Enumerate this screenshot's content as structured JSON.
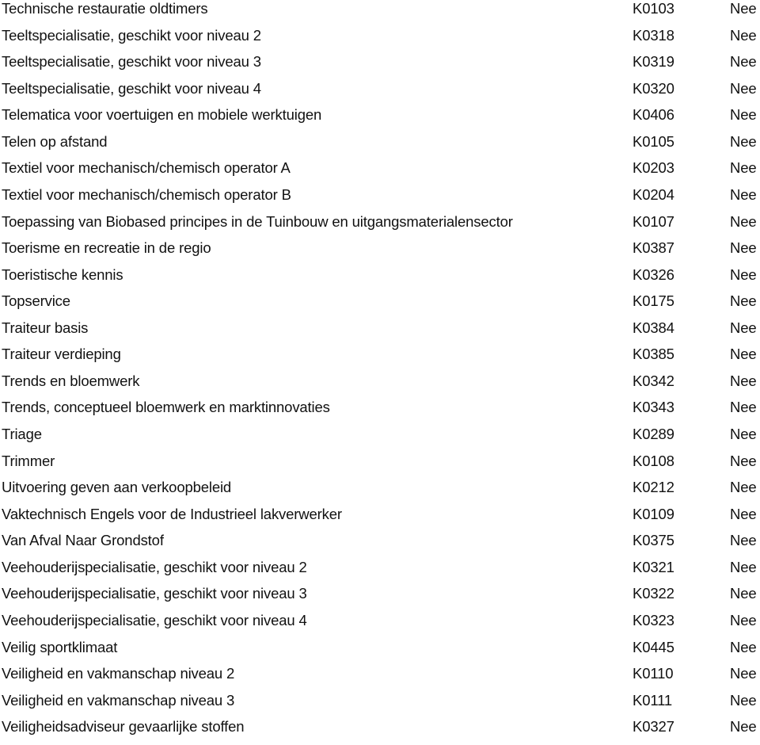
{
  "table": {
    "rows": [
      {
        "name": "Technische restauratie oldtimers",
        "code": "K0103",
        "value": "Nee"
      },
      {
        "name": "Teeltspecialisatie, geschikt voor niveau 2",
        "code": "K0318",
        "value": "Nee"
      },
      {
        "name": "Teeltspecialisatie, geschikt voor niveau 3",
        "code": "K0319",
        "value": "Nee"
      },
      {
        "name": "Teeltspecialisatie, geschikt voor niveau 4",
        "code": "K0320",
        "value": "Nee"
      },
      {
        "name": "Telematica voor voertuigen en mobiele werktuigen",
        "code": "K0406",
        "value": "Nee"
      },
      {
        "name": "Telen op afstand",
        "code": "K0105",
        "value": "Nee"
      },
      {
        "name": "Textiel voor mechanisch/chemisch operator A",
        "code": "K0203",
        "value": "Nee"
      },
      {
        "name": "Textiel voor mechanisch/chemisch operator B",
        "code": "K0204",
        "value": "Nee"
      },
      {
        "name": "Toepassing van Biobased principes in de Tuinbouw en uitgangsmaterialensector",
        "code": "K0107",
        "value": "Nee"
      },
      {
        "name": "Toerisme en recreatie in de regio",
        "code": "K0387",
        "value": "Nee"
      },
      {
        "name": "Toeristische kennis",
        "code": "K0326",
        "value": "Nee"
      },
      {
        "name": "Topservice",
        "code": "K0175",
        "value": "Nee"
      },
      {
        "name": "Traiteur basis",
        "code": "K0384",
        "value": "Nee"
      },
      {
        "name": "Traiteur verdieping",
        "code": "K0385",
        "value": "Nee"
      },
      {
        "name": "Trends en bloemwerk",
        "code": "K0342",
        "value": "Nee"
      },
      {
        "name": "Trends, conceptueel bloemwerk en marktinnovaties",
        "code": "K0343",
        "value": "Nee"
      },
      {
        "name": "Triage",
        "code": "K0289",
        "value": "Nee"
      },
      {
        "name": "Trimmer",
        "code": "K0108",
        "value": "Nee"
      },
      {
        "name": "Uitvoering geven aan verkoopbeleid",
        "code": "K0212",
        "value": "Nee"
      },
      {
        "name": "Vaktechnisch Engels voor de Industrieel lakverwerker",
        "code": "K0109",
        "value": "Nee"
      },
      {
        "name": "Van Afval Naar Grondstof",
        "code": "K0375",
        "value": "Nee"
      },
      {
        "name": "Veehouderijspecialisatie, geschikt voor niveau 2",
        "code": "K0321",
        "value": "Nee"
      },
      {
        "name": "Veehouderijspecialisatie, geschikt voor niveau 3",
        "code": "K0322",
        "value": "Nee"
      },
      {
        "name": "Veehouderijspecialisatie, geschikt voor niveau 4",
        "code": "K0323",
        "value": "Nee"
      },
      {
        "name": "Veilig sportklimaat",
        "code": "K0445",
        "value": "Nee"
      },
      {
        "name": "Veiligheid en vakmanschap niveau 2",
        "code": "K0110",
        "value": "Nee"
      },
      {
        "name": "Veiligheid en vakmanschap niveau 3",
        "code": "K0111",
        "value": "Nee"
      },
      {
        "name": "Veiligheidsadviseur gevaarlijke stoffen",
        "code": "K0327",
        "value": "Nee"
      }
    ]
  }
}
